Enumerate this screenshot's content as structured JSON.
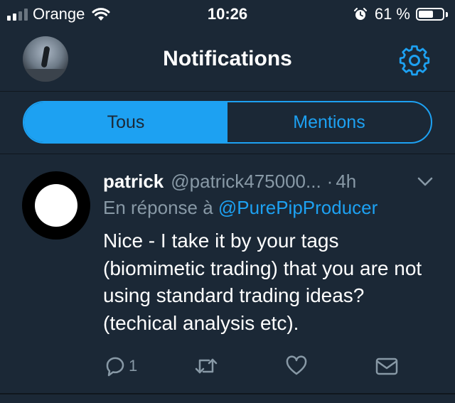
{
  "status_bar": {
    "carrier": "Orange",
    "time": "10:26",
    "battery_percent": "61 %",
    "battery_level": 0.61,
    "signal_bars": 2,
    "icons": [
      "signal-icon",
      "wifi-icon",
      "alarm-icon",
      "battery-icon"
    ]
  },
  "header": {
    "title": "Notifications",
    "avatar_icon": "profile-avatar",
    "settings_icon": "gear-icon"
  },
  "tabs": [
    {
      "label": "Tous",
      "active": true
    },
    {
      "label": "Mentions",
      "active": false
    }
  ],
  "tweet": {
    "name": "patrick",
    "handle": "@patrick475000...",
    "separator": "·",
    "time": "4h",
    "reply_prefix": "En réponse à",
    "reply_to": "@PurePipProducer",
    "text": "Nice - I take it by your tags (biomimetic trading) that you are not using standard trading ideas? (techical analysis etc).",
    "reply_count": "1"
  },
  "colors": {
    "background": "#1b2836",
    "accent": "#1da1f2",
    "secondary_text": "#8899a6"
  }
}
